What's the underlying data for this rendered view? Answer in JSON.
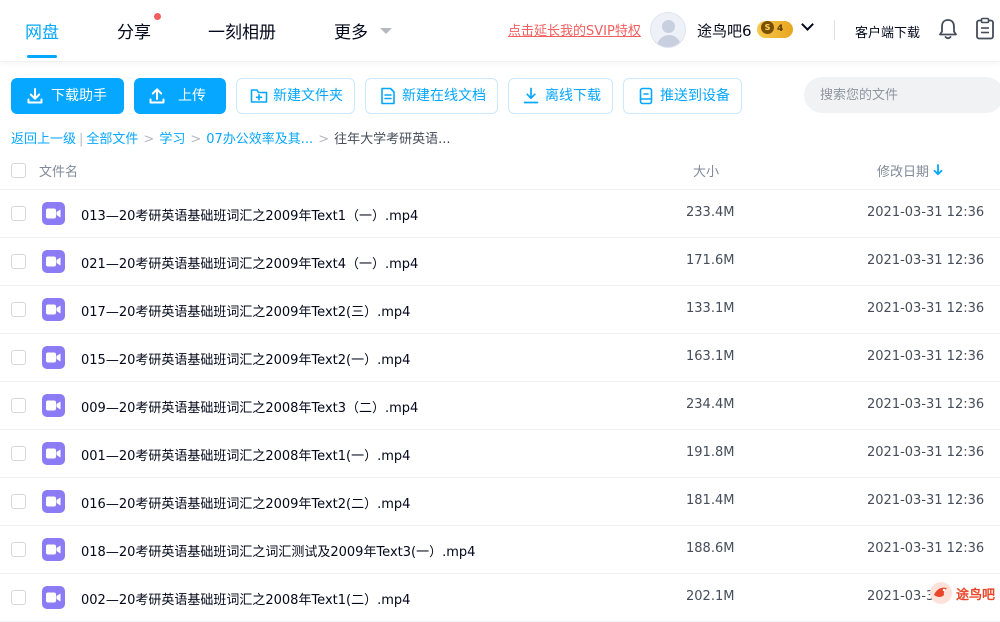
{
  "nav": {
    "items": [
      {
        "label": "网盘",
        "active": true
      },
      {
        "label": "分享",
        "has_notification": true
      },
      {
        "label": "一刻相册"
      },
      {
        "label": "更多",
        "has_dropdown": true
      }
    ]
  },
  "header": {
    "svip_link": "点击延长我的SVIP特权",
    "username": "途鸟吧6",
    "vip_level": "4",
    "vip_badge_letter": "S",
    "client_download": "客户端下载"
  },
  "toolbar": {
    "download_helper": "下载助手",
    "upload": "上传",
    "new_folder": "新建文件夹",
    "new_online_doc": "新建在线文档",
    "offline_download": "离线下载",
    "push_to_device": "推送到设备",
    "search_placeholder": "搜索您的文件"
  },
  "breadcrumb": {
    "back": "返回上一级",
    "divider": "|",
    "items": [
      "全部文件",
      "学习",
      "07办公效率及其..."
    ],
    "current": "往年大学考研英语..."
  },
  "table": {
    "columns": {
      "name": "文件名",
      "size": "大小",
      "date": "修改日期"
    },
    "sort": {
      "column": "date",
      "direction": "desc"
    },
    "rows": [
      {
        "name": "013—20考研英语基础班词汇之2009年Text1（一）.mp4",
        "size": "233.4M",
        "date": "2021-03-31 12:36"
      },
      {
        "name": "021—20考研英语基础班词汇之2009年Text4（一）.mp4",
        "size": "171.6M",
        "date": "2021-03-31 12:36"
      },
      {
        "name": "017—20考研英语基础班词汇之2009年Text2(三）.mp4",
        "size": "133.1M",
        "date": "2021-03-31 12:36"
      },
      {
        "name": "015—20考研英语基础班词汇之2009年Text2(一）.mp4",
        "size": "163.1M",
        "date": "2021-03-31 12:36"
      },
      {
        "name": "009—20考研英语基础班词汇之2008年Text3（二）.mp4",
        "size": "234.4M",
        "date": "2021-03-31 12:36"
      },
      {
        "name": "001—20考研英语基础班词汇之2008年Text1(一）.mp4",
        "size": "191.8M",
        "date": "2021-03-31 12:36"
      },
      {
        "name": "016—20考研英语基础班词汇之2009年Text2(二）.mp4",
        "size": "181.4M",
        "date": "2021-03-31 12:36"
      },
      {
        "name": "018—20考研英语基础班词汇之词汇测试及2009年Text3(一）.mp4",
        "size": "188.6M",
        "date": "2021-03-31 12:36"
      },
      {
        "name": "002—20考研英语基础班词汇之2008年Text1(二）.mp4",
        "size": "202.1M",
        "date": "2021-03-3"
      }
    ]
  },
  "watermark": {
    "text": "途鸟吧"
  },
  "colors": {
    "accent": "#06a7ff",
    "notice_red": "#f25d5d",
    "video_icon": "#8b7cf6",
    "text_main": "#03081a"
  },
  "icons": {
    "toolbar": [
      "download-icon",
      "upload-icon",
      "new-folder-icon",
      "document-icon",
      "offline-download-icon",
      "device-push-icon"
    ],
    "header": [
      "avatar",
      "chevron-down-icon",
      "bell-icon",
      "clipboard-icon"
    ],
    "file": "video-file-icon"
  }
}
